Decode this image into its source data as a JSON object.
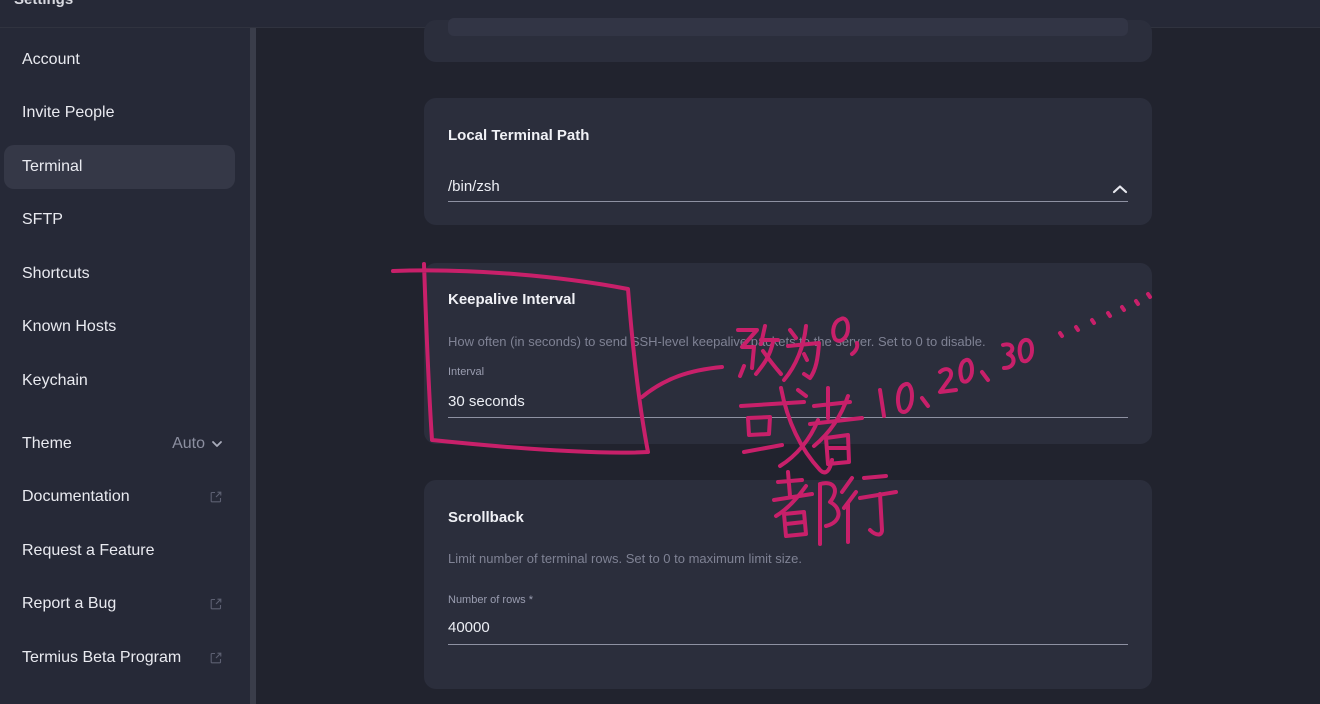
{
  "window": {
    "title": "Settings"
  },
  "sidebar": {
    "items": [
      {
        "label": "Account"
      },
      {
        "label": "Invite People"
      },
      {
        "label": "Terminal",
        "active": true
      },
      {
        "label": "SFTP"
      },
      {
        "label": "Shortcuts"
      },
      {
        "label": "Known Hosts"
      },
      {
        "label": "Keychain"
      },
      {
        "label": "Theme",
        "value": "Auto",
        "icon": "chevron-down-icon"
      },
      {
        "label": "Documentation",
        "icon": "external-link-icon"
      },
      {
        "label": "Request a Feature"
      },
      {
        "label": "Report a Bug",
        "icon": "external-link-icon"
      },
      {
        "label": "Termius Beta Program",
        "icon": "external-link-icon"
      }
    ]
  },
  "main": {
    "local_terminal": {
      "title": "Local Terminal Path",
      "value": "/bin/zsh",
      "icon": "chevron-up-icon"
    },
    "keepalive": {
      "title": "Keepalive Interval",
      "description": "How often (in seconds) to send SSH-level keepalive packets to the server. Set to 0 to disable.",
      "field_label": "Interval",
      "value": "30 seconds"
    },
    "scrollback": {
      "title": "Scrollback",
      "description": "Limit number of terminal rows. Set to 0 to maximum limit size.",
      "field_label": "Number of rows *",
      "value": "40000"
    }
  },
  "annotation": {
    "color": "#c8206a",
    "text": "改为0，或者10、20、30……都行"
  }
}
